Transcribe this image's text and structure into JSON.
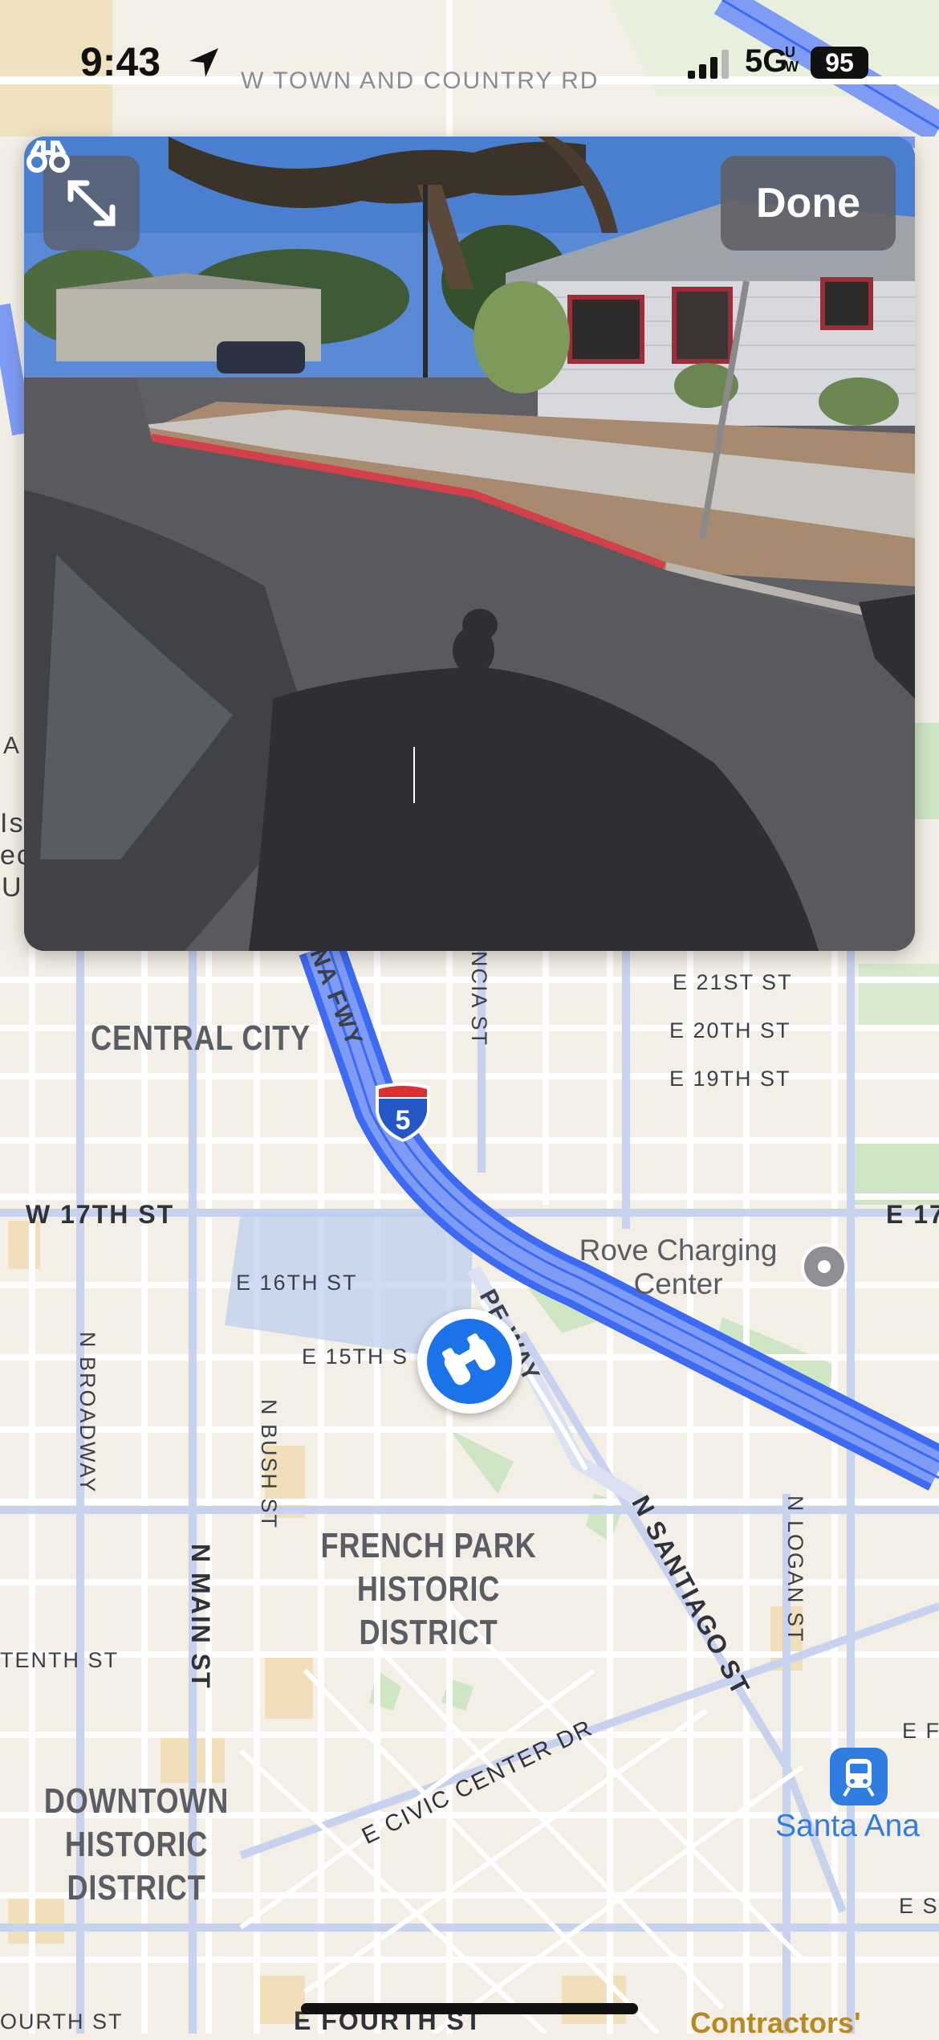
{
  "status_bar": {
    "time": "9:43",
    "network": "5G",
    "network_sup": "UW",
    "battery": "95"
  },
  "look_around": {
    "done_label": "Done",
    "expand_icon": "expand-icon",
    "binoculars_icon": "binoculars-icon"
  },
  "map": {
    "streets": {
      "town_country": "W TOWN AND COUNTRY RD",
      "freeway": "NA FWY",
      "garcia": "NCIA ST",
      "e21": "E 21ST ST",
      "e20": "E 20TH ST",
      "e19": "E 19TH ST",
      "w17": "W 17TH ST",
      "e17": "E 17",
      "e16": "E 16TH ST",
      "e15": "E 15TH S",
      "pacific": "PE  WAY",
      "broadway": "N BROADWAY",
      "bush": "N BUSH ST",
      "main": "N MAIN ST",
      "santiago": "N SANTIAGO ST",
      "logan": "N LOGAN ST",
      "tenth": "TENTH ST",
      "civic": "E CIVIC CENTER DR",
      "fourth_w": "OURTH ST",
      "fourth_e": "E FOURTH ST",
      "ef": "E F",
      "es": "E S",
      "edge_a": "A",
      "edge_is": "Is",
      "edge_ec": "ec",
      "edge_u": "U"
    },
    "districts": {
      "central_city": "CENTRAL CITY",
      "french_park": [
        "FRENCH PARK",
        "HISTORIC",
        "DISTRICT"
      ],
      "downtown": [
        "DOWNTOWN",
        "HISTORIC",
        "DISTRICT"
      ]
    },
    "poi": {
      "rove": [
        "Rove Charging",
        "Center"
      ],
      "santa_ana": "Santa Ana",
      "contractors": "Contractors'"
    },
    "shield_number": "5"
  }
}
